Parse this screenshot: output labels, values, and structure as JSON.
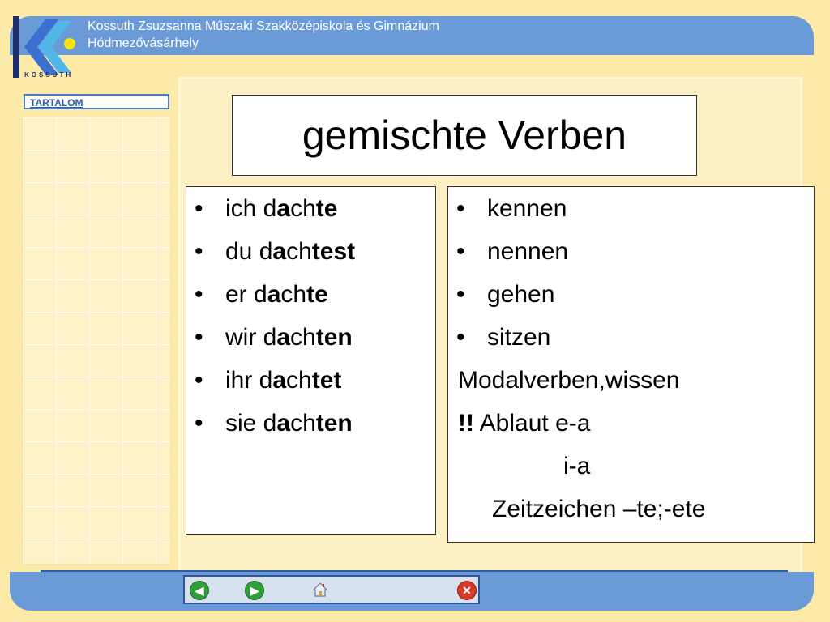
{
  "header": {
    "title": "Kossuth Zsuzsanna Műszaki Szakközépiskola és Gimnázium",
    "subtitle": "Hódmezővásárhely",
    "logo_text": "KOSSUTH"
  },
  "sidebar": {
    "tartalom_label": "TARTALOM"
  },
  "slide": {
    "title": "gemischte Verben",
    "left_items": [
      {
        "pre": "ich d",
        "mid": "a",
        "stem": "ch",
        "ending": "te"
      },
      {
        "pre": "du d",
        "mid": "a",
        "stem": "ch",
        "ending": "test"
      },
      {
        "pre": "er d",
        "mid": "a",
        "stem": "ch",
        "ending": "te"
      },
      {
        "pre": "wir d",
        "mid": "a",
        "stem": "ch",
        "ending": "ten"
      },
      {
        "pre": "ihr d",
        "mid": "a",
        "stem": "ch",
        "ending": "tet"
      },
      {
        "pre": "sie d",
        "mid": "a",
        "stem": "ch",
        "ending": "ten"
      }
    ],
    "right_items": [
      "kennen",
      "nennen",
      "gehen",
      "sitzen"
    ],
    "right_line1": "Modalverben,wissen",
    "right_line2_bold": "!!",
    "right_line2": " Ablaut e-a",
    "right_line3": "i-a",
    "right_line4": "Zeitzeichen –te;-ete"
  },
  "navigation": {
    "back_icon": "arrow-left-icon",
    "forward_icon": "arrow-right-icon",
    "home_icon": "home-icon",
    "close_icon": "close-icon",
    "colors": {
      "green": "#2f9e3a",
      "red": "#d63b2a",
      "bar": "#6a9bd6"
    }
  }
}
